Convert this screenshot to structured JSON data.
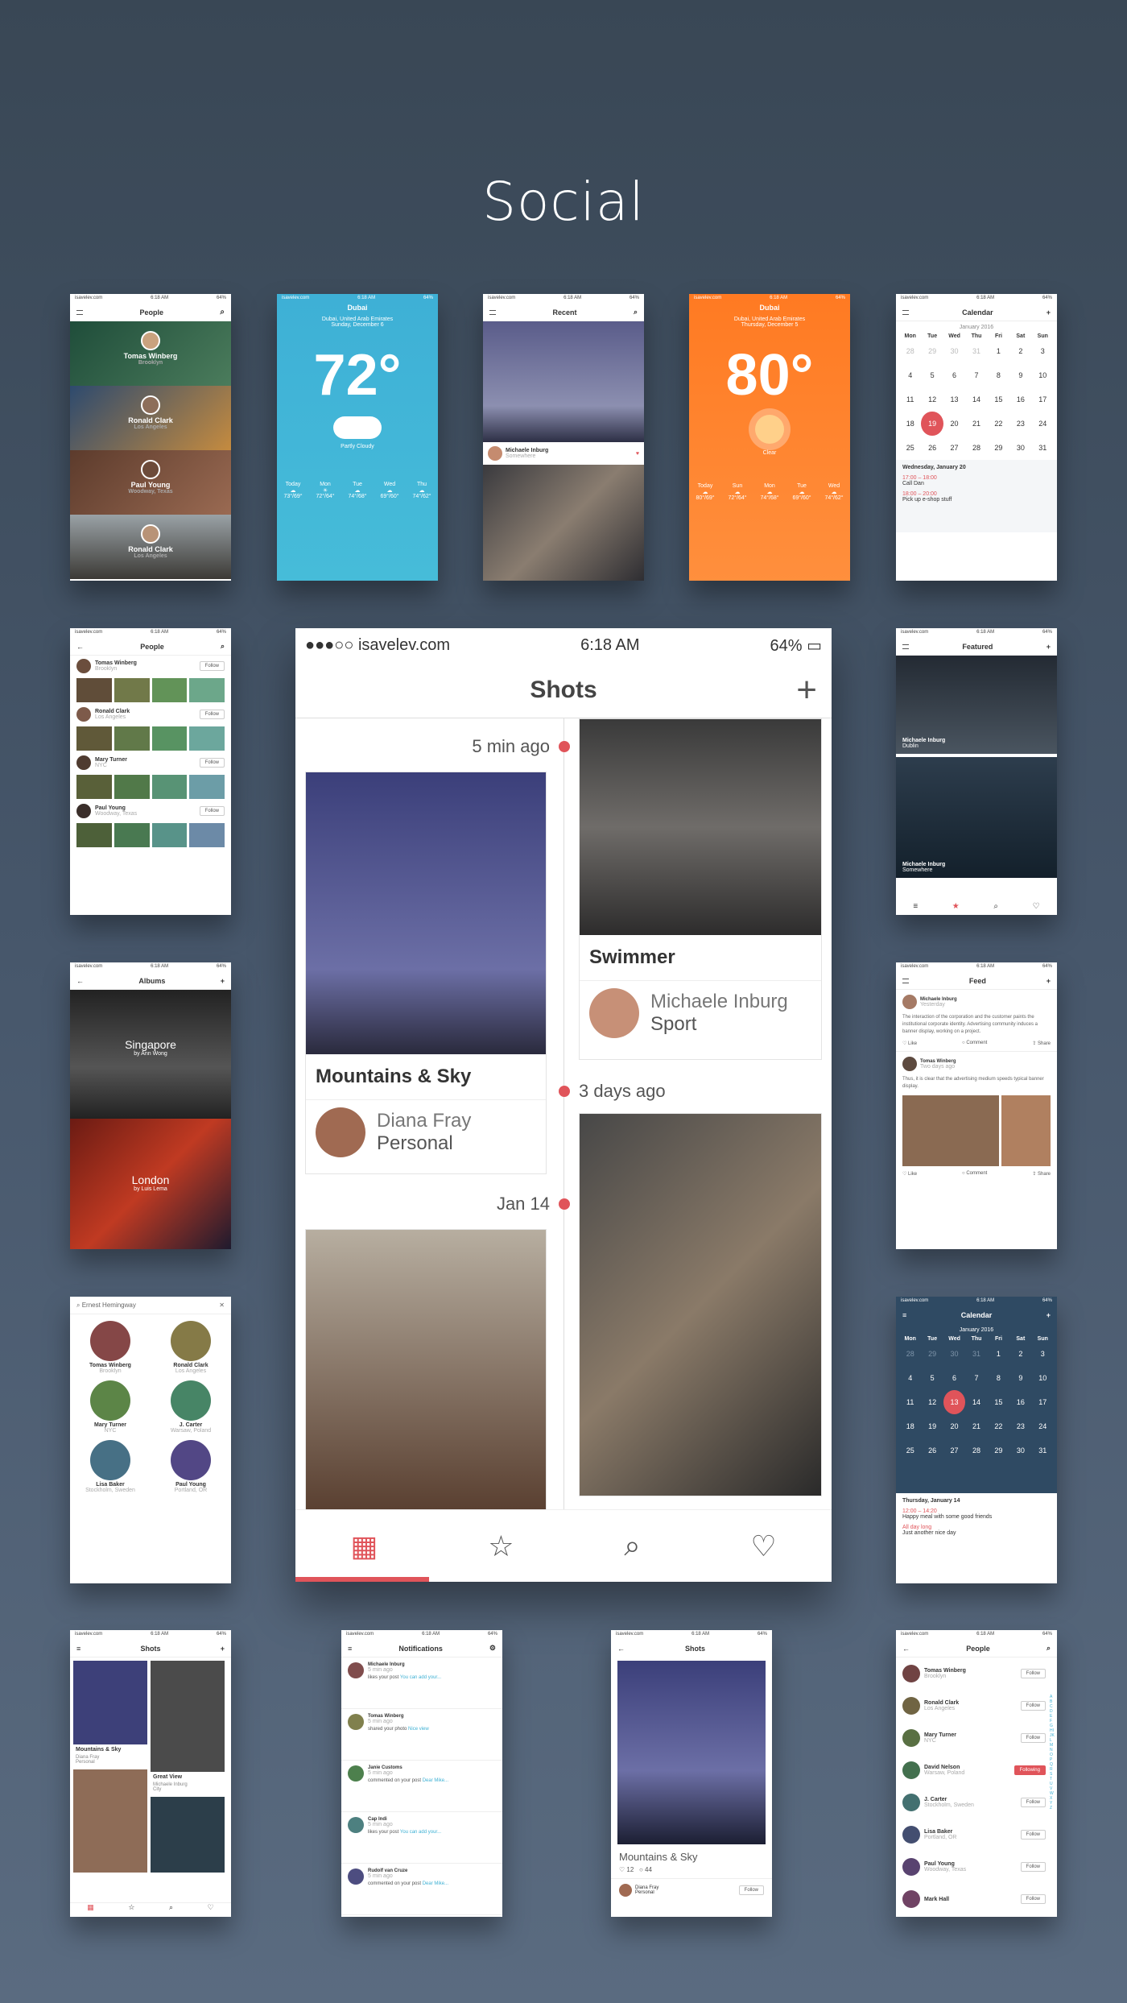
{
  "page": {
    "title": "Social"
  },
  "status": {
    "carrier": "isavelev.com",
    "time": "6:18 AM",
    "battery": "64%"
  },
  "people": {
    "title": "People",
    "items": [
      {
        "name": "Tomas Winberg",
        "place": "Brooklyn"
      },
      {
        "name": "Ronald Clark",
        "place": "Los Angeles"
      },
      {
        "name": "Paul Young",
        "place": "Woodway, Texas"
      },
      {
        "name": "Ronald Clark",
        "place": "Los Angeles"
      }
    ]
  },
  "weather1": {
    "city": "Dubai",
    "sub": "Dubai, United Arab Emirates",
    "date": "Sunday, December 6",
    "temp": "72°",
    "cond": "Partly Cloudy",
    "days": [
      "Today",
      "Mon",
      "Tue",
      "Wed",
      "Thu"
    ],
    "temps": [
      "73°/69°",
      "72°/64°",
      "74°/68°",
      "69°/60°",
      "74°/62°"
    ]
  },
  "recent": {
    "title": "Recent",
    "name": "Michaele Inburg",
    "place": "Somewhere"
  },
  "weather2": {
    "city": "Dubai",
    "sub": "Dubai, United Arab Emirates",
    "date": "Thursday, December 5",
    "temp": "80°",
    "cond": "Clear",
    "days": [
      "Today",
      "Sun",
      "Mon",
      "Tue",
      "Wed"
    ],
    "temps": [
      "80°/69°",
      "72°/64°",
      "74°/68°",
      "69°/60°",
      "74°/62°"
    ]
  },
  "calendar": {
    "title": "Calendar",
    "month": "January 2016",
    "dow": [
      "Mon",
      "Tue",
      "Wed",
      "Thu",
      "Fri",
      "Sat",
      "Sun"
    ],
    "days": [
      "28",
      "29",
      "30",
      "31",
      "1",
      "2",
      "3",
      "4",
      "5",
      "6",
      "7",
      "8",
      "9",
      "10",
      "11",
      "12",
      "13",
      "14",
      "15",
      "16",
      "17",
      "18",
      "19",
      "20",
      "21",
      "22",
      "23",
      "24",
      "25",
      "26",
      "27",
      "28",
      "29",
      "30",
      "31"
    ],
    "sel_date": "Wednesday, January 20",
    "events": [
      {
        "t": "17:00 – 18:00",
        "d": "Call Dan"
      },
      {
        "t": "18:00 – 20:00",
        "d": "Pick up e-shop stuff"
      }
    ]
  },
  "calendar2": {
    "sel_date": "Thursday, January 14",
    "events": [
      {
        "t": "12:00 – 14:20",
        "d": "Happy meal with some good friends"
      },
      {
        "t": "All day long",
        "d": "Just another nice day"
      }
    ]
  },
  "people2": {
    "title": "People",
    "follow": "Follow",
    "items": [
      {
        "name": "Tomas Winberg",
        "place": "Brooklyn"
      },
      {
        "name": "Ronald Clark",
        "place": "Los Angeles"
      },
      {
        "name": "Mary Turner",
        "place": "NYC"
      },
      {
        "name": "Paul Young",
        "place": "Woodway, Texas"
      }
    ]
  },
  "shots": {
    "title": "Shots",
    "c1": {
      "time": "5 min ago",
      "title": "Mountains & Sky",
      "name": "Diana Fray",
      "cat": "Personal"
    },
    "c2": {
      "title": "Swimmer",
      "name": "Michaele Inburg",
      "cat": "Sport"
    },
    "t2": "3 days ago",
    "t3": "Jan 14"
  },
  "featured": {
    "title": "Featured",
    "items": [
      {
        "name": "Michaele Inburg",
        "place": "Dublin"
      },
      {
        "name": "Michaele Inburg",
        "place": "Somewhere"
      }
    ]
  },
  "albums": {
    "title": "Albums",
    "items": [
      {
        "name": "Singapore",
        "by": "by Ann Wong"
      },
      {
        "name": "London",
        "by": "by Luis Lema"
      }
    ]
  },
  "feed": {
    "title": "Feed",
    "p1": {
      "name": "Michaele Inburg",
      "time": "Yesterday",
      "text": "The interaction of the corporation and the customer paints the institutional corporate identity. Advertising community induces a banner display, working on a project."
    },
    "p2": {
      "name": "Tomas Winberg",
      "time": "Two days ago",
      "text": "Thus, it is clear that the advertising medium speeds typical banner display."
    },
    "like": "Like",
    "comment": "Comment",
    "share": "Share"
  },
  "search": {
    "query": "Ernest Hemingway",
    "items": [
      {
        "name": "Tomas Winberg",
        "place": "Brooklyn"
      },
      {
        "name": "Ronald Clark",
        "place": "Los Angeles"
      },
      {
        "name": "Mary Turner",
        "place": "NYC"
      },
      {
        "name": "J. Carter",
        "place": "Warsaw, Poland"
      },
      {
        "name": "Lisa Baker",
        "place": "Stockholm, Sweden"
      },
      {
        "name": "Paul Young",
        "place": "Portland, OR"
      }
    ]
  },
  "shots2": {
    "title": "Shots",
    "a": "Mountains & Sky",
    "an": "Diana Fray",
    "ac": "Personal",
    "b": "Great View",
    "bn": "Michaele Inburg",
    "bc": "City"
  },
  "notif": {
    "title": "Notifications",
    "items": [
      {
        "name": "Michaele Inburg",
        "time": "5 min ago",
        "act": "likes your post",
        "link": "You can add your..."
      },
      {
        "name": "Tomas Winberg",
        "time": "5 min ago",
        "act": "shared your photo",
        "link": "Nice view"
      },
      {
        "name": "Janie Customs",
        "time": "5 min ago",
        "act": "commented on your post",
        "link": "Dear Mike..."
      },
      {
        "name": "Cap Indi",
        "time": "5 min ago",
        "act": "likes your post",
        "link": "You can add your..."
      },
      {
        "name": "Rudolf van Cruze",
        "time": "5 min ago",
        "act": "commented on your post",
        "link": "Dear Mike..."
      }
    ]
  },
  "shotdetail": {
    "title": "Shots",
    "name": "Mountains & Sky",
    "likes": "12",
    "comments": "44",
    "user": "Diana Fray",
    "cat": "Personal",
    "follow": "Follow"
  },
  "people3": {
    "title": "People",
    "items": [
      {
        "name": "Tomas Winberg",
        "place": "Brooklyn",
        "btn": "Follow"
      },
      {
        "name": "Ronald Clark",
        "place": "Los Angeles",
        "btn": "Follow"
      },
      {
        "name": "Mary Turner",
        "place": "NYC",
        "btn": "Follow"
      },
      {
        "name": "David Nelson",
        "place": "Warsaw, Poland",
        "btn": "Following"
      },
      {
        "name": "J. Carter",
        "place": "Stockholm, Sweden",
        "btn": "Follow"
      },
      {
        "name": "Lisa Baker",
        "place": "Portland, OR",
        "btn": "Follow"
      },
      {
        "name": "Paul Young",
        "place": "Woodway, Texas",
        "btn": "Follow"
      },
      {
        "name": "Mark Hall",
        "place": "",
        "btn": "Follow"
      }
    ],
    "letters": "ABCDEFGHIJKLMNOPQRSTUVWXYZ"
  },
  "colors": {
    "accent": "#e0545a",
    "weather_blue": "#3fb1d4",
    "weather_orange": "#ff7b2b",
    "cal_dark": "#2f4a63"
  }
}
